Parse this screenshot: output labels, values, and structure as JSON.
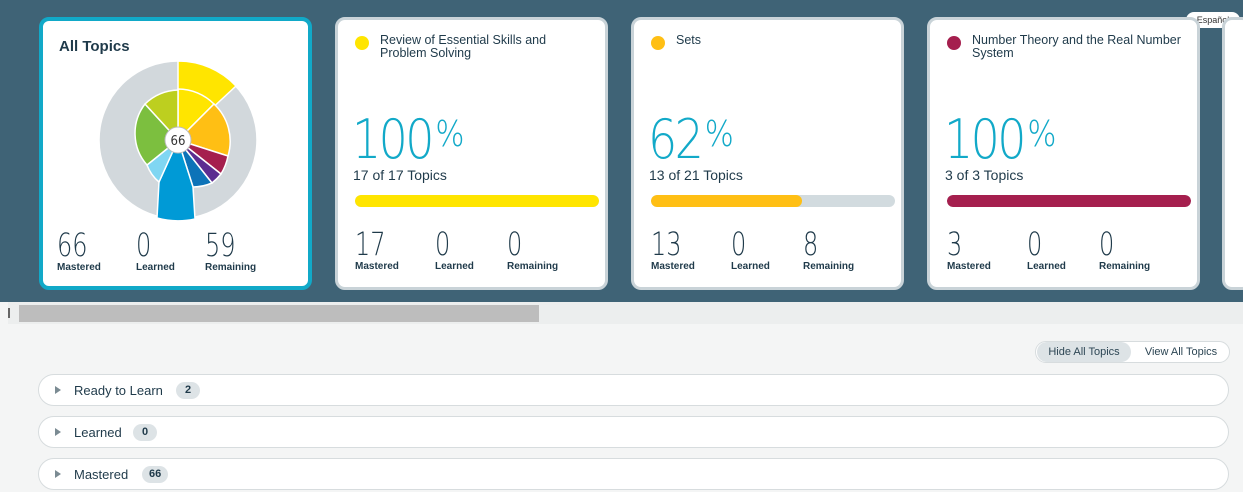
{
  "language_button": "Español",
  "all_topics": {
    "title": "All Topics",
    "center_count": "66",
    "stats": [
      {
        "value": "66",
        "label": "Mastered"
      },
      {
        "value": "0",
        "label": "Learned"
      },
      {
        "value": "59",
        "label": "Remaining"
      }
    ]
  },
  "topic_cards": [
    {
      "title": "Review of Essential Skills and Problem Solving",
      "color": "#ffe500",
      "percent": "100",
      "percent_sign": "%",
      "progress_fraction": 1.0,
      "of_text": "17 of 17 Topics",
      "stats": [
        {
          "value": "17",
          "label": "Mastered"
        },
        {
          "value": "0",
          "label": "Learned"
        },
        {
          "value": "0",
          "label": "Remaining"
        }
      ]
    },
    {
      "title": "Sets",
      "color": "#ffbf14",
      "percent": "62",
      "percent_sign": "%",
      "progress_fraction": 0.62,
      "of_text": "13 of 21 Topics",
      "stats": [
        {
          "value": "13",
          "label": "Mastered"
        },
        {
          "value": "0",
          "label": "Learned"
        },
        {
          "value": "8",
          "label": "Remaining"
        }
      ]
    },
    {
      "title": "Number Theory and the Real Number System",
      "color": "#a51f4e",
      "percent": "100",
      "percent_sign": "%",
      "progress_fraction": 1.0,
      "of_text": "3 of 3 Topics",
      "stats": [
        {
          "value": "3",
          "label": "Mastered"
        },
        {
          "value": "0",
          "label": "Learned"
        },
        {
          "value": "0",
          "label": "Remaining"
        }
      ]
    }
  ],
  "toggle": {
    "hide_label": "Hide All Topics",
    "view_label": "View All Topics"
  },
  "sections": [
    {
      "label": "Ready to Learn",
      "count": "2"
    },
    {
      "label": "Learned",
      "count": "0"
    },
    {
      "label": "Mastered",
      "count": "66"
    }
  ],
  "colors": {
    "banner": "#3f6376",
    "accent": "#12a9c8",
    "pie_remaining": "#d2d8dc"
  }
}
